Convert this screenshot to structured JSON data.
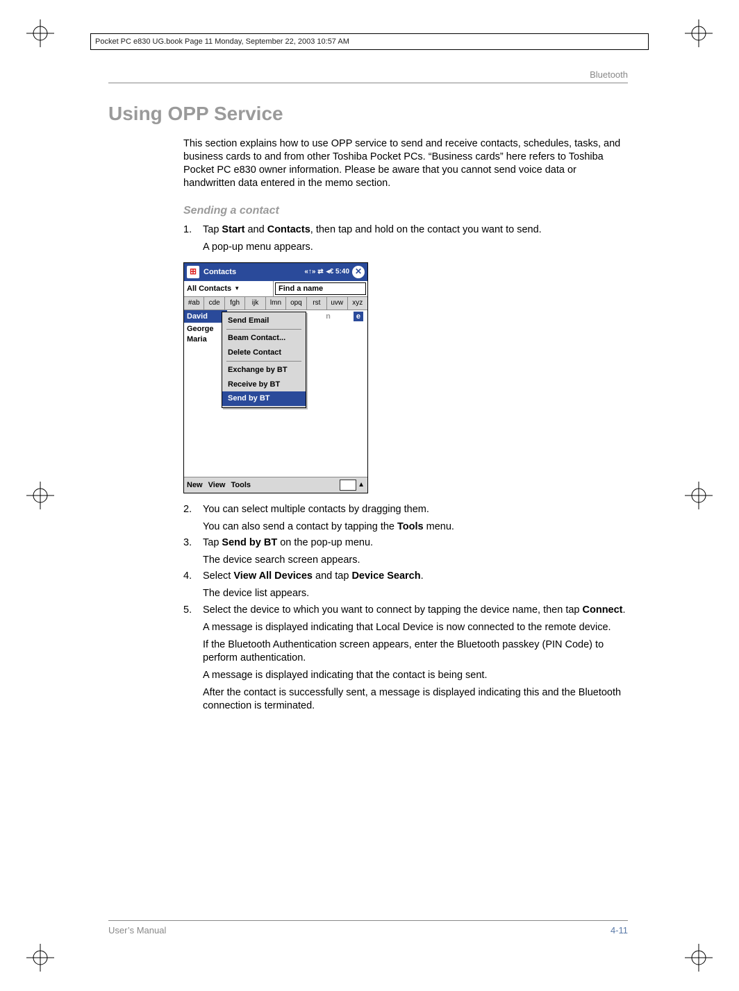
{
  "header_strip": "Pocket PC e830 UG.book  Page 11  Monday, September 22, 2003  10:57 AM",
  "running_head": "Bluetooth",
  "h1": "Using OPP Service",
  "intro": "This section explains how to use OPP service to send and receive contacts, schedules, tasks, and business cards to and from other Toshiba Pocket PCs. “Business cards” here refers to Toshiba Pocket PC e830 owner information. Please be aware that you cannot send voice data or handwritten data entered in the memo section.",
  "h2": "Sending a contact",
  "steps": {
    "s1_num": "1.",
    "s1_a": "Tap ",
    "s1_b1": "Start",
    "s1_c": " and ",
    "s1_b2": "Contacts",
    "s1_d": ", then tap and hold on the contact you want to send.",
    "s1_sub": "A pop-up menu appears.",
    "s2_num": "2.",
    "s2_a": "You can select multiple contacts by dragging them.",
    "s2_b": "You can also send a contact by tapping the ",
    "s2_b_bold": "Tools",
    "s2_c": " menu.",
    "s3_num": "3.",
    "s3_a": "Tap ",
    "s3_bold": "Send by BT",
    "s3_b": " on the pop-up menu.",
    "s3_sub": "The device search screen appears.",
    "s4_num": "4.",
    "s4_a": "Select ",
    "s4_bold1": "View All Devices",
    "s4_b": " and tap ",
    "s4_bold2": "Device Search",
    "s4_c": ".",
    "s4_sub": "The device list appears.",
    "s5_num": "5.",
    "s5_a": "Select the device to which you want to connect by tapping the device name, then tap ",
    "s5_bold": "Connect",
    "s5_b": ".",
    "s5_sub1": "A message is displayed indicating that Local Device is now connected to the remote device.",
    "s5_sub2": "If the Bluetooth Authentication screen appears, enter the Bluetooth passkey (PIN Code) to perform authentication.",
    "s5_sub3": "A message is displayed indicating that the contact is being sent.",
    "s5_sub4": "After the contact is successfully sent, a message is displayed indicating this and the Bluetooth connection is terminated."
  },
  "screenshot": {
    "title": "Contacts",
    "tray": "◂€ 5:40",
    "tray_icons": "«↑»  ⇄",
    "close": "✕",
    "category": "All Contacts",
    "find_placeholder": "Find a name",
    "alpha": [
      "#ab",
      "cde",
      "fgh",
      "ijk",
      "lmn",
      "opq",
      "rst",
      "uvw",
      "xyz"
    ],
    "names": [
      "David",
      "George",
      "Maria"
    ],
    "initials_left": "n",
    "initials_right": "e",
    "menu": {
      "m1": "Send Email",
      "m2": "Beam Contact...",
      "m3": "Delete Contact",
      "m4": "Exchange by BT",
      "m5": "Receive by BT",
      "m6": "Send by BT"
    },
    "menubar": {
      "new": "New",
      "view": "View",
      "tools": "Tools",
      "up": "▲"
    }
  },
  "footer": {
    "left": "User’s Manual",
    "right": "4-11"
  }
}
